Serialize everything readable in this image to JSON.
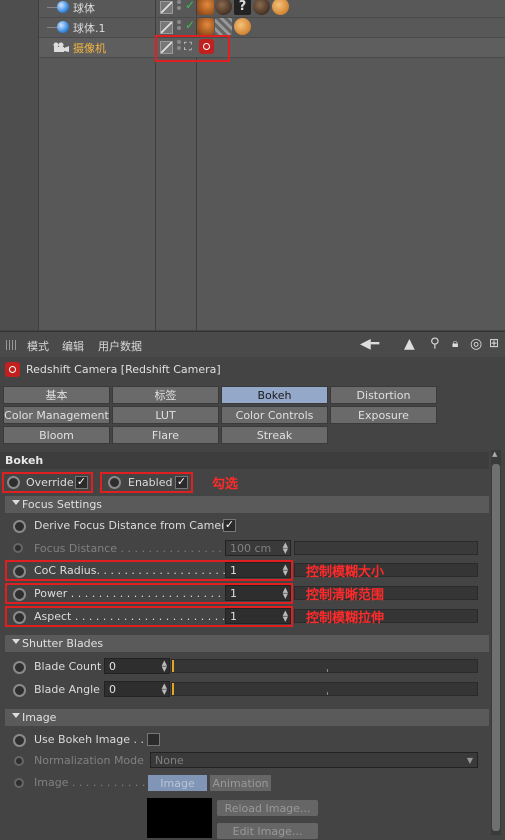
{
  "objects": [
    {
      "name": "球体"
    },
    {
      "name": "球体.1"
    },
    {
      "name": "摄像机"
    }
  ],
  "menubar": {
    "mode": "模式",
    "edit": "编辑",
    "userdata": "用户数据"
  },
  "object_title": "Redshift Camera [Redshift Camera]",
  "tabs": [
    [
      "基本",
      "标签",
      "Bokeh",
      "Distortion"
    ],
    [
      "Color Management",
      "LUT",
      "Color Controls",
      "Exposure"
    ],
    [
      "Bloom",
      "Flare",
      "Streak"
    ]
  ],
  "bokeh": {
    "section": "Bokeh",
    "override": "Override",
    "enabled": "Enabled",
    "check_mark": "✓",
    "annotation_select": "勾选",
    "focus_group": "Focus Settings",
    "derive_focus": "Derive Focus Distance from Camera",
    "focus_distance_label": "Focus Distance . . . . . . . . . . . . . . . . .",
    "focus_distance_value": "100 cm",
    "coc_label": "CoC Radius. . . . . . . . . . . . . . . . . . . . .",
    "coc_value": "1",
    "coc_annotation": "控制模糊大小",
    "power_label": "Power . . . . . . . . . . . . . . . . . . . . . . .",
    "power_value": "1",
    "power_annotation": "控制清晰范围",
    "aspect_label": "Aspect . . . . . . . . . . . . . . . . . . . . . . .",
    "aspect_value": "1",
    "aspect_annotation": "控制模糊拉伸",
    "shutter_group": "Shutter Blades",
    "blade_count_label": "Blade Count",
    "blade_count_value": "0",
    "blade_angle_label": "Blade Angle",
    "blade_angle_value": "0",
    "image_group": "Image",
    "use_bokeh_image": "Use Bokeh Image . .",
    "normalization_label": "Normalization Mode",
    "normalization_value": "None",
    "image_label": "Image . . . . . . . . . . .",
    "image_tab": "Image",
    "animation_tab": "Animation",
    "reload_btn": "Reload Image...",
    "edit_btn": "Edit Image..."
  },
  "colors": {
    "accent_tab": "#94a9c9",
    "annotation": "#ff2a2a",
    "selected_object": "#f3b541",
    "redshift_red": "#c21f1f"
  }
}
